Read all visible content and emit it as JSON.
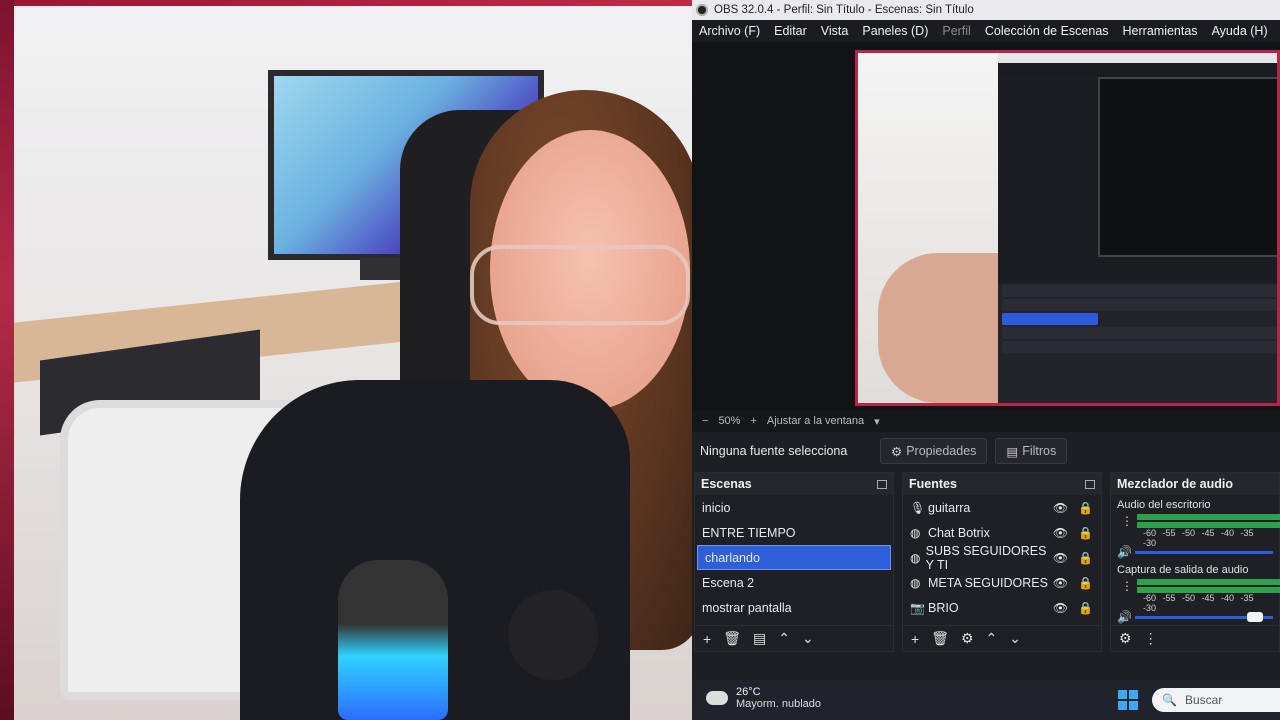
{
  "titlebar": {
    "text": "OBS 32.0.4 - Perfil: Sin Título - Escenas: Sin Título"
  },
  "menu": [
    "Archivo (F)",
    "Editar",
    "Vista",
    "Paneles (D)",
    "Perfil",
    "Colección de Escenas",
    "Herramientas",
    "Ayuda (H)"
  ],
  "zoom": {
    "minus": "−",
    "value": "50%",
    "plus": "+",
    "fit": "Ajustar a la ventana",
    "caret": "▾"
  },
  "properties_bar": {
    "no_source": "Ninguna fuente selecciona",
    "properties": "Propiedades",
    "filters": "Filtros"
  },
  "scenes": {
    "title": "Escenas",
    "items": [
      "inicio",
      "ENTRE TIEMPO",
      "charlando",
      "Escena 2",
      "mostrar pantalla"
    ],
    "selected": "charlando"
  },
  "sources": {
    "title": "Fuentes",
    "items": [
      {
        "name": "guitarra",
        "icon": "mic-icon"
      },
      {
        "name": "Chat Botrix",
        "icon": "globe-icon"
      },
      {
        "name": "SUBS SEGUIDORES Y TI",
        "icon": "globe-icon"
      },
      {
        "name": "META SEGUIDORES",
        "icon": "globe-icon"
      },
      {
        "name": "BRIO",
        "icon": "camera-icon"
      }
    ]
  },
  "mixer": {
    "title": "Mezclador de audio",
    "channels": [
      {
        "name": "Audio del escritorio",
        "ticks": "-60 -55 -50 -45 -40 -35 -30"
      },
      {
        "name": "Captura de salida de audio",
        "ticks": "-60 -55 -50 -45 -40 -35 -30"
      }
    ]
  },
  "taskbar": {
    "temp": "26°C",
    "weather": "Mayorm. nublado",
    "search": "Buscar"
  },
  "colors": {
    "accent": "#2e5fd8",
    "meter": "#2fa14a",
    "border_red": "#b3284a"
  }
}
